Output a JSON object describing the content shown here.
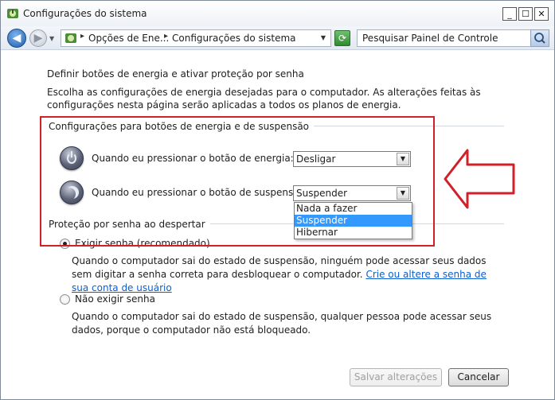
{
  "window": {
    "title": "Configurações do sistema",
    "controls": {
      "minimize": "_",
      "maximize": "☐",
      "close": "✕"
    }
  },
  "navigation": {
    "back_icon": "back-arrow-icon",
    "forward_icon": "forward-arrow-icon",
    "breadcrumbs": [
      "Opções de Ene...",
      "Configurações do sistema"
    ],
    "search_placeholder": "Pesquisar Painel de Controle"
  },
  "page": {
    "heading": "Definir botões de energia e ativar proteção por senha",
    "description": "Escolha as configurações de energia desejadas para o computador. As alterações feitas às configurações nesta página serão aplicadas a todos os planos de energia."
  },
  "power_section": {
    "title": "Configurações para botões de energia e de suspensão",
    "power_button": {
      "label": "Quando eu pressionar o botão de energia:",
      "value": "Desligar"
    },
    "sleep_button": {
      "label": "Quando eu pressionar o botão de suspensão:",
      "value": "Suspender",
      "options": [
        "Nada a fazer",
        "Suspender",
        "Hibernar"
      ],
      "selected_option": "Suspender"
    }
  },
  "password_section": {
    "title": "Proteção por senha ao despertar",
    "require": {
      "label": "Exigir senha (recomendado)",
      "checked": true,
      "description": "Quando o computador sai do estado de suspensão, ninguém pode acessar seus dados sem digitar a senha correta para desbloquear o computador.",
      "link": "Crie ou altere a senha de sua conta de usuário"
    },
    "no_require": {
      "label": "Não exigir senha",
      "checked": false,
      "description": "Quando o computador sai do estado de suspensão, qualquer pessoa pode acessar seus dados, porque o computador não está bloqueado."
    }
  },
  "footer": {
    "save_label": "Salvar alterações",
    "cancel_label": "Cancelar"
  },
  "annotation": {
    "color": "#d0202a"
  }
}
